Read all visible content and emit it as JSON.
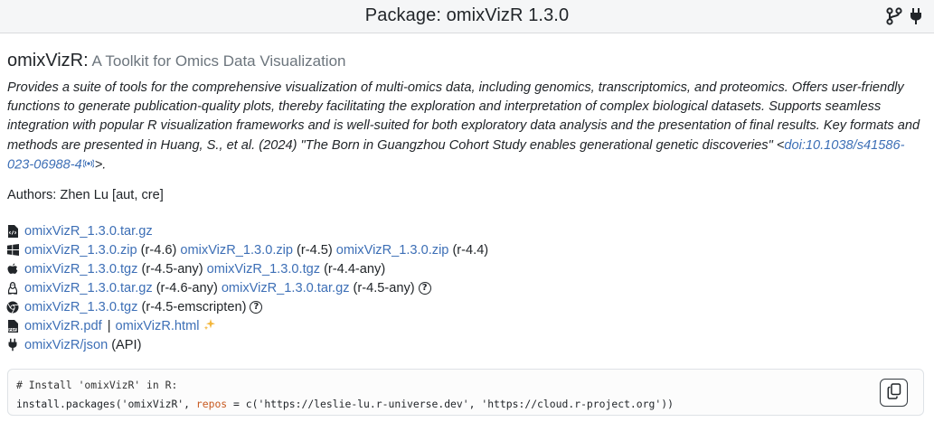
{
  "header": {
    "title": "Package: omixVizR 1.3.0",
    "icons": [
      "git-branch-icon",
      "plug-icon"
    ]
  },
  "package": {
    "name": "omixVizR",
    "colon": ":",
    "subtitle": "A Toolkit for Omics Data Visualization"
  },
  "description": {
    "text": "Provides a suite of tools for the comprehensive visualization of multi-omics data, including genomics, transcriptomics, and proteomics. Offers user-friendly functions to generate publication-quality plots, thereby facilitating the exploration and interpretation of complex biological datasets. Supports seamless integration with popular R visualization frameworks and is well-suited for both exploratory data analysis and the presentation of final results. Key formats and methods are presented in Huang, S., et al. (2024) \"The Born in Guangzhou Cohort Study enables generational genetic discoveries\" <",
    "doi_link": "doi:10.1038/s41586-023-06988-4",
    "suffix": ">."
  },
  "authors": "Authors: Zhen Lu [aut, cre]",
  "downloads": {
    "source": {
      "file": "omixVizR_1.3.0.tar.gz"
    },
    "windows": [
      {
        "file": "omixVizR_1.3.0.zip",
        "note": "(r-4.6)"
      },
      {
        "file": "omixVizR_1.3.0.zip",
        "note": "(r-4.5)"
      },
      {
        "file": "omixVizR_1.3.0.zip",
        "note": "(r-4.4)"
      }
    ],
    "macos": [
      {
        "file": "omixVizR_1.3.0.tgz",
        "note": "(r-4.5-any)"
      },
      {
        "file": "omixVizR_1.3.0.tgz",
        "note": "(r-4.4-any)"
      }
    ],
    "linux": [
      {
        "file": "omixVizR_1.3.0.tar.gz",
        "note": "(r-4.6-any)"
      },
      {
        "file": "omixVizR_1.3.0.tar.gz",
        "note": "(r-4.5-any)"
      }
    ],
    "wasm": {
      "file": "omixVizR_1.3.0.tgz",
      "note": "(r-4.5-emscripten)"
    },
    "docs": {
      "pdf": "omixVizR.pdf",
      "separator": "|",
      "html": "omixVizR.html"
    },
    "api": {
      "link": "omixVizR/json",
      "note": "(API)"
    },
    "help_glyph": "?"
  },
  "install": {
    "comment": "# Install 'omixVizR' in R:",
    "fn": "install.packages('omixVizR', ",
    "arg": "repos",
    "rest": " = c('https://leslie-lu.r-universe.dev', 'https://cloud.r-project.org'))"
  }
}
